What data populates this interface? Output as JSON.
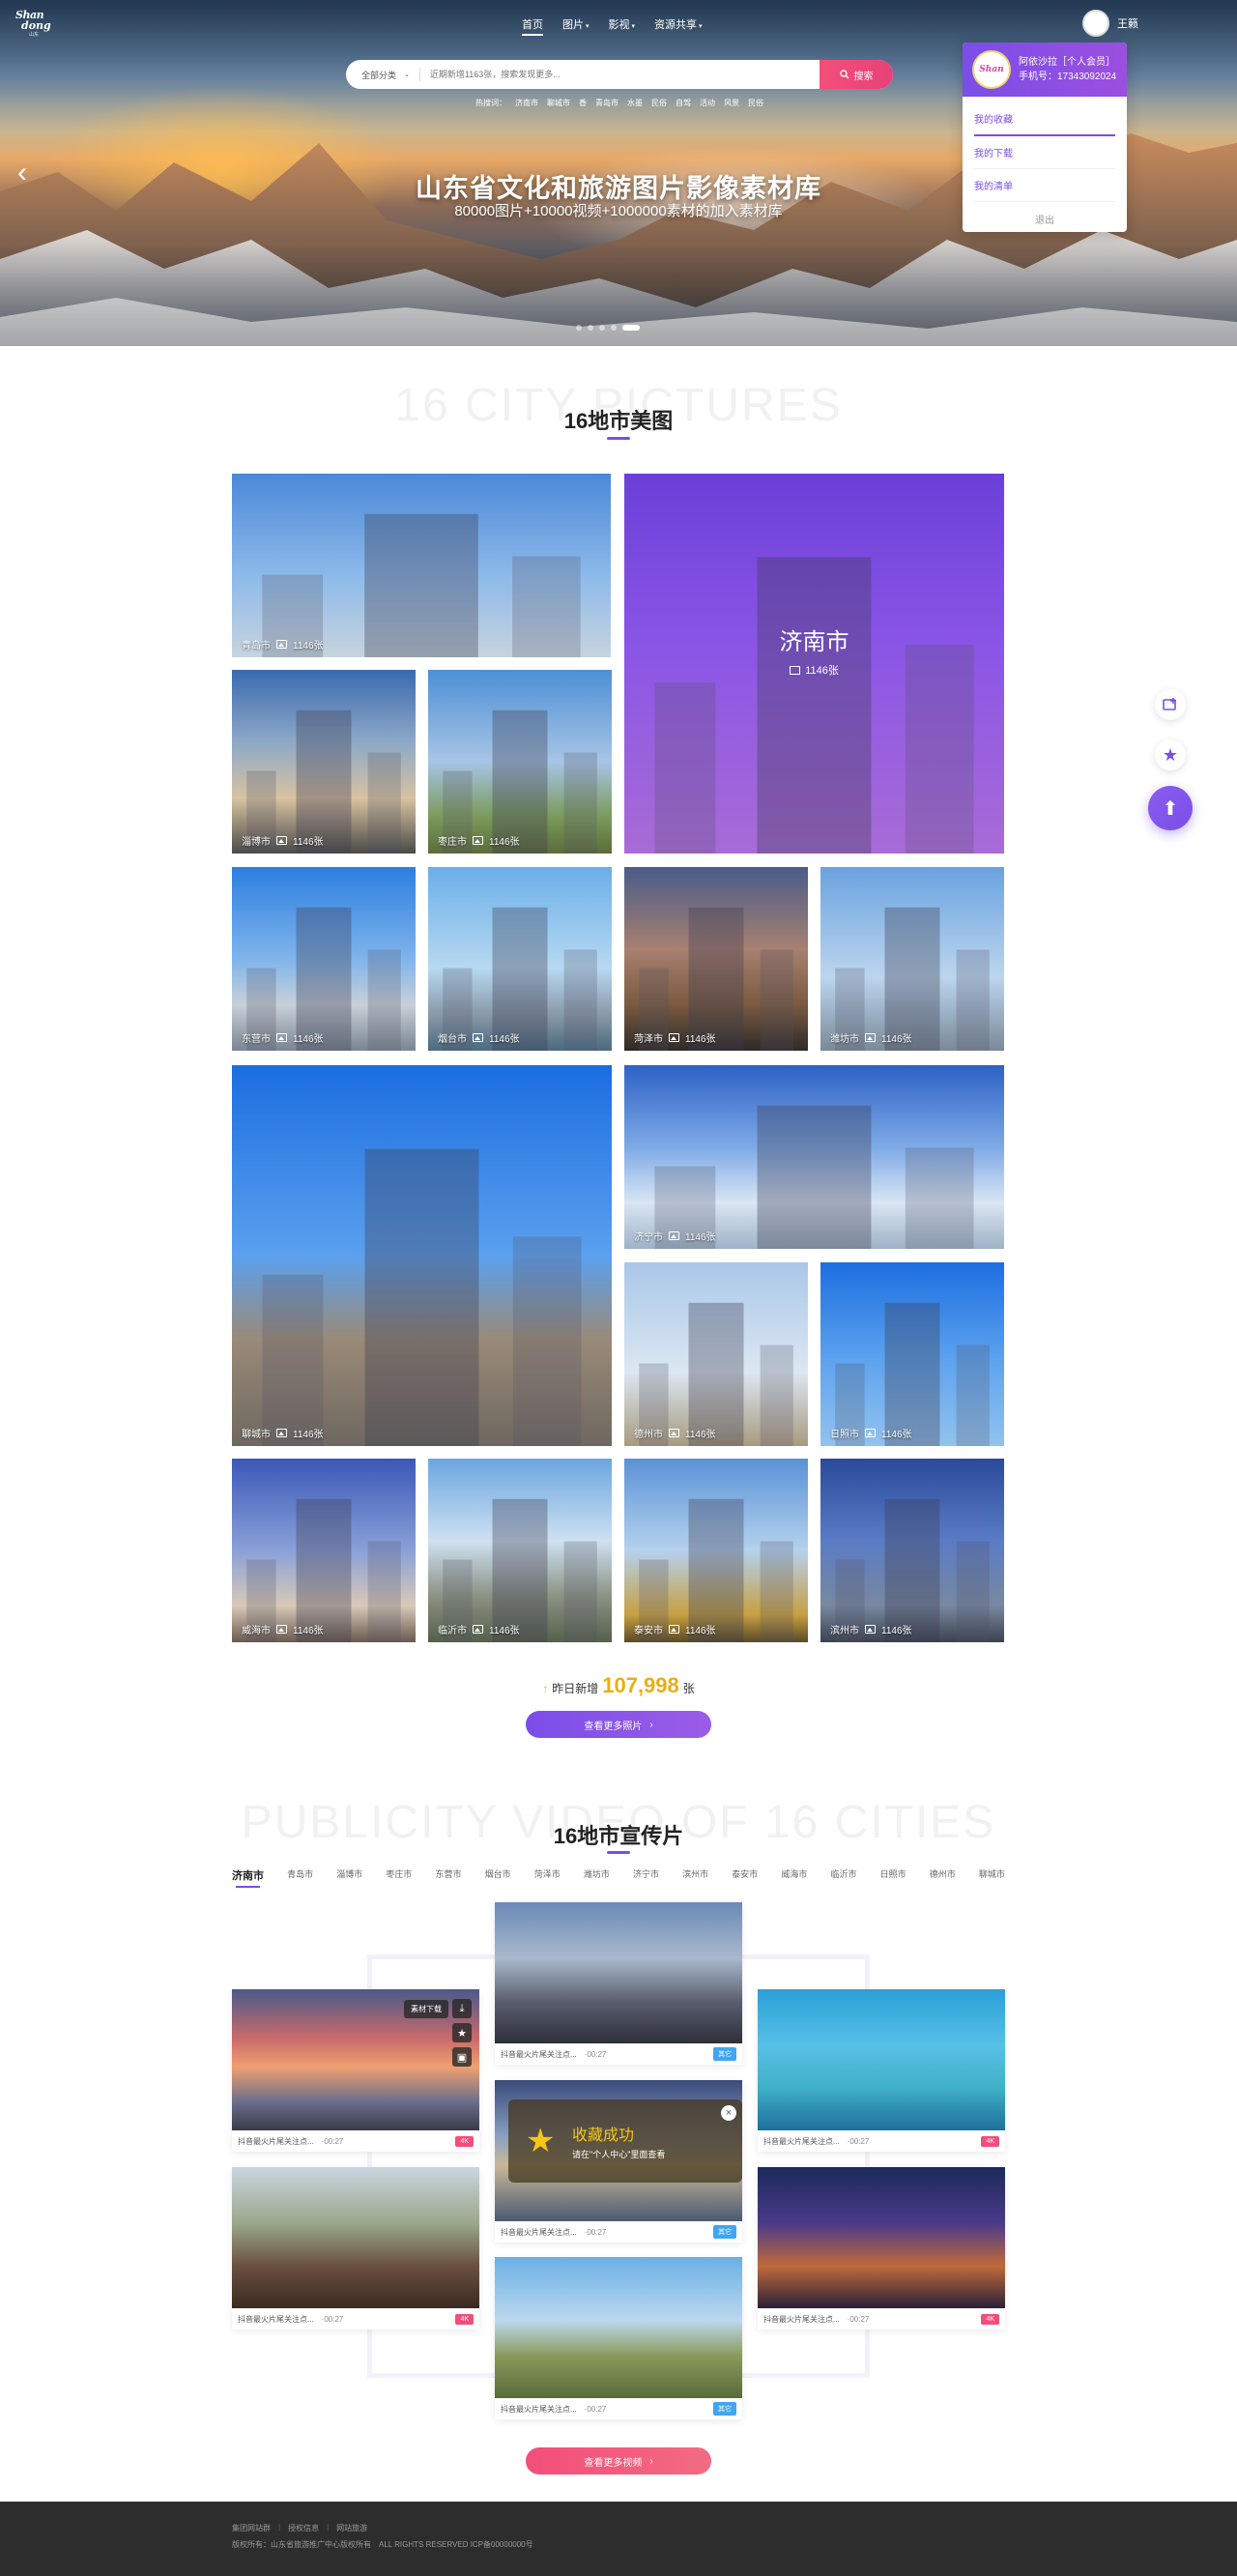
{
  "logo": {
    "line1": "Shan",
    "line2": "dong",
    "line3": "山东"
  },
  "nav": {
    "items": [
      {
        "label": "首页",
        "caret": ""
      },
      {
        "label": "图片",
        "caret": "▾"
      },
      {
        "label": "影视",
        "caret": "▾"
      },
      {
        "label": "资源共享",
        "caret": "▾"
      }
    ]
  },
  "user": {
    "name": "王籁"
  },
  "dropdown": {
    "title": "阿依沙拉［个人会员］",
    "phone": "手机号：17343092024",
    "links": [
      "我的收藏",
      "我的下载",
      "我的清单"
    ],
    "logout": "退出"
  },
  "search": {
    "category": "全部分类",
    "placeholder": "近期新增1163张，搜索发现更多...",
    "button": "搜索"
  },
  "hot": {
    "label": "热搜词：",
    "words": [
      "济南市",
      "聊城市",
      "香",
      "青岛市",
      "水墨",
      "民俗",
      "自驾",
      "活动",
      "风景",
      "民俗"
    ]
  },
  "hero": {
    "title": "山东省文化和旅游图片影像素材库",
    "subtitle": "80000图片+10000视频+1000000素材的加入素材库"
  },
  "photos_section": {
    "bg_title": "16 CITY PICTURES",
    "title": "16地市美图"
  },
  "tiles": [
    {
      "city": "青岛市",
      "count": "1146张"
    },
    {
      "city": "济南市",
      "count": "1146张"
    },
    {
      "city": "淄博市",
      "count": "1146张"
    },
    {
      "city": "枣庄市",
      "count": "1146张"
    },
    {
      "city": "东营市",
      "count": "1146张"
    },
    {
      "city": "烟台市",
      "count": "1146张"
    },
    {
      "city": "菏泽市",
      "count": "1146张"
    },
    {
      "city": "潍坊市",
      "count": "1146张"
    },
    {
      "city": "聊城市",
      "count": "1146张"
    },
    {
      "city": "济宁市",
      "count": "1146张"
    },
    {
      "city": "德州市",
      "count": "1146张"
    },
    {
      "city": "日照市",
      "count": "1146张"
    },
    {
      "city": "威海市",
      "count": "1146张"
    },
    {
      "city": "临沂市",
      "count": "1146张"
    },
    {
      "city": "泰安市",
      "count": "1146张"
    },
    {
      "city": "滨州市",
      "count": "1146张"
    }
  ],
  "stats": {
    "prefix": "昨日新增",
    "number": "107,998",
    "suffix": "张"
  },
  "more_photos": "查看更多照片",
  "videos_section": {
    "bg_title": "PUBLICITY VIDEO OF 16 CITIES",
    "title": "16地市宣传片"
  },
  "video_tabs": [
    "济南市",
    "青岛市",
    "淄博市",
    "枣庄市",
    "东营市",
    "烟台市",
    "菏泽市",
    "潍坊市",
    "济宁市",
    "滨州市",
    "泰安市",
    "威海市",
    "临沂市",
    "日照市",
    "德州市",
    "聊城市"
  ],
  "videos": [
    {
      "title": "抖音最火片尾关注点...",
      "duration": "00:27",
      "badge": "4K"
    },
    {
      "title": "抖音最火片尾关注点...",
      "duration": "00:27",
      "badge": "其它"
    },
    {
      "title": "抖音最火片尾关注点...",
      "duration": "00:27",
      "badge": "4K"
    },
    {
      "title": "抖音最火片尾关注点...",
      "duration": "00:27",
      "badge": "4K"
    },
    {
      "title": "抖音最火片尾关注点...",
      "duration": "00:27",
      "badge": "其它"
    },
    {
      "title": "抖音最火片尾关注点...",
      "duration": "00:27",
      "badge": "4K"
    },
    {
      "title": "抖音最火片尾关注点...",
      "duration": "00:27",
      "badge": "其它"
    }
  ],
  "video_tools": {
    "download": "素材下载"
  },
  "toast": {
    "title": "收藏成功",
    "sub": "请在\"个人中心\"里面查看"
  },
  "more_videos": "查看更多视频",
  "footer": {
    "links": [
      "集团网站群",
      "授权信息",
      "网站旅游"
    ],
    "copyright": "版权所有：山东省旅游推广中心版权所有　ALL RIGHTS RESERVED  ICP备00000000号"
  },
  "colors": {
    "accent": "#7b4ee8",
    "pink": "#f24e7b",
    "gold": "#e8b00f",
    "badge_4k": "#f24e7b",
    "badge_other": "#3fa6f4"
  }
}
